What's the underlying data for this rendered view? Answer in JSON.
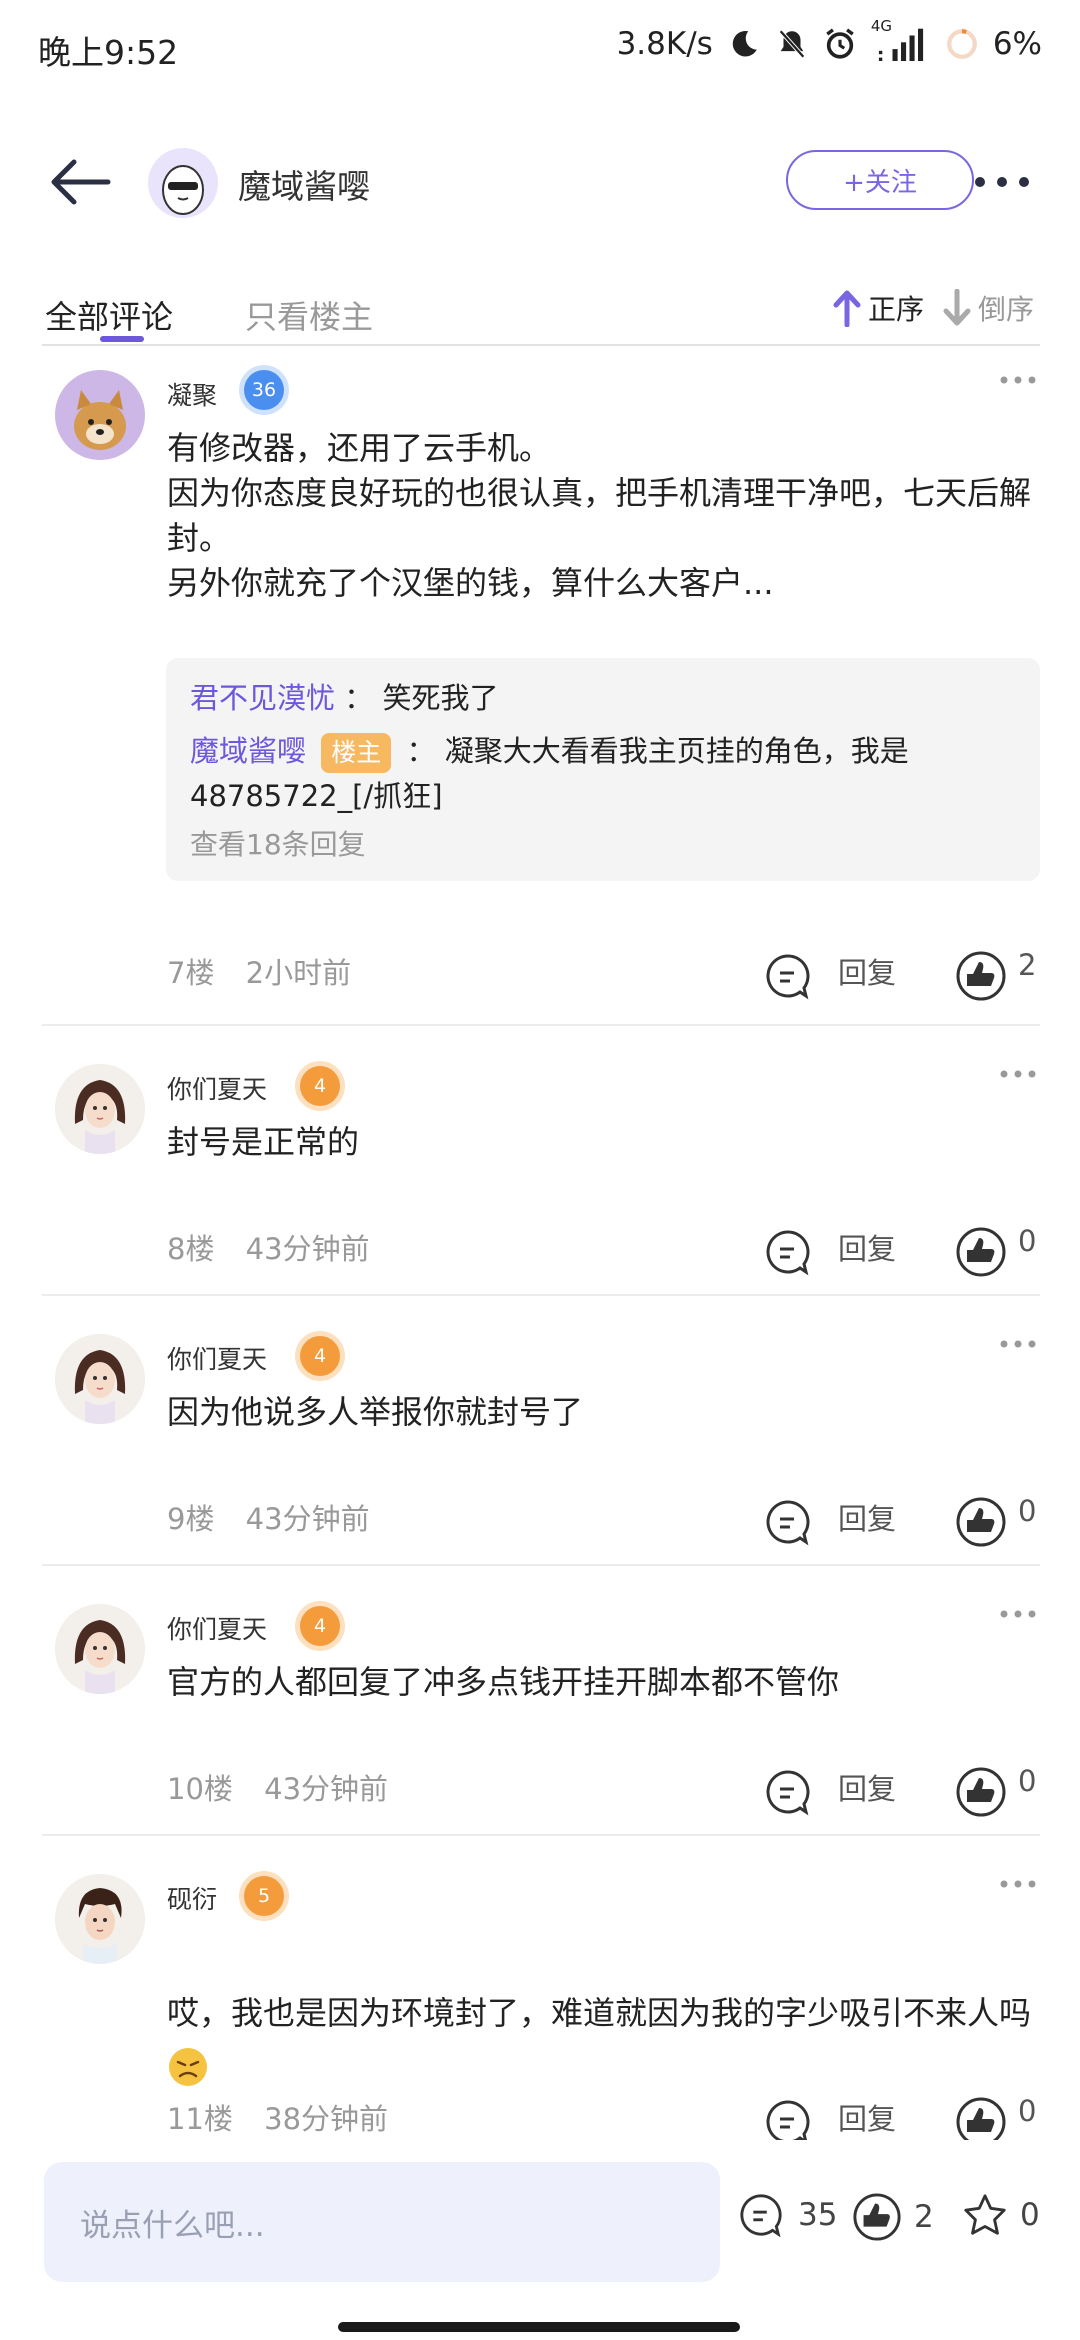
{
  "status_bar": {
    "time": "晚上9:52",
    "speed": "3.8K/s",
    "network": "4G",
    "battery": "6%"
  },
  "header": {
    "title": "魔域酱嘤",
    "follow_label": "+关注"
  },
  "tabs": {
    "all": "全部评论",
    "owner_only": "只看楼主",
    "sort_asc": "正序",
    "sort_desc": "倒序"
  },
  "comments": [
    {
      "user": "凝聚",
      "level": "36",
      "text": "有修改器，还用了云手机。\n因为你态度良好玩的也很认真，把手机清理干净吧，七天后解封。\n另外你就充了个汉堡的钱，算什么大客户...",
      "replies": [
        {
          "name": "君不见漠忧",
          "tag": "",
          "text": "笑死我了"
        },
        {
          "name": "魔域酱嘤",
          "tag": "楼主",
          "text": "凝聚大大看看我主页挂的角色，我是48785722_[/抓狂]"
        }
      ],
      "view_more": "查看18条回复",
      "floor": "7楼",
      "time": "2小时前",
      "reply_label": "回复",
      "likes": "2"
    },
    {
      "user": "你们夏天",
      "level": "4",
      "text": "封号是正常的",
      "floor": "8楼",
      "time": "43分钟前",
      "reply_label": "回复",
      "likes": "0"
    },
    {
      "user": "你们夏天",
      "level": "4",
      "text": "因为他说多人举报你就封号了",
      "floor": "9楼",
      "time": "43分钟前",
      "reply_label": "回复",
      "likes": "0"
    },
    {
      "user": "你们夏天",
      "level": "4",
      "text": "官方的人都回复了冲多点钱开挂开脚本都不管你",
      "floor": "10楼",
      "time": "43分钟前",
      "reply_label": "回复",
      "likes": "0"
    },
    {
      "user": "砚衍",
      "level": "5",
      "text": "哎，我也是因为环境封了，难道就因为我的字少吸引不来人吗",
      "floor": "11楼",
      "time": "38分钟前",
      "reply_label": "回复",
      "likes": "0"
    }
  ],
  "bottom_bar": {
    "input_placeholder": "说点什么吧...",
    "comment_count": "35",
    "like_count": "2",
    "star_count": "0"
  },
  "colors": {
    "accent": "#6d58db",
    "owner_tag": "#f7b862",
    "level_blue": "#4a8ff0",
    "level_orange": "#f49b3c"
  }
}
